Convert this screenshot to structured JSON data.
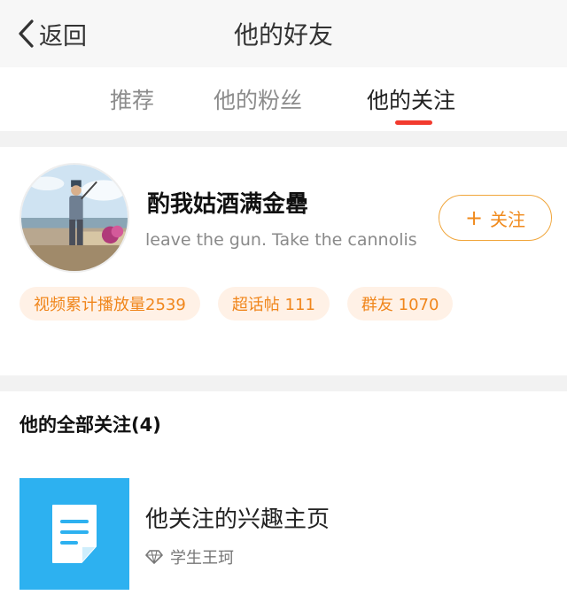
{
  "nav": {
    "back_label": "返回",
    "title": "他的好友"
  },
  "tabs": [
    {
      "label": "推荐"
    },
    {
      "label": "他的粉丝"
    },
    {
      "label": "他的关注"
    }
  ],
  "active_tab": "他的关注",
  "profile": {
    "name": "酌我姑酒满金罍",
    "bio": "leave the gun. Take the cannolis",
    "follow_button": {
      "plus": "+",
      "label": "关注"
    },
    "tags": [
      {
        "text": "视频累计播放量2539"
      },
      {
        "text": "超话帖 111"
      },
      {
        "text": "群友 1070"
      }
    ]
  },
  "following": {
    "section_title": "他的全部关注(4)",
    "items": [
      {
        "title": "他关注的兴趣主页",
        "subtitle": "学生王珂",
        "icon": "document-icon",
        "badge_icon": "diamond-icon"
      }
    ]
  },
  "colors": {
    "accent": "#f08a1c",
    "tab_underline": "#f23a2e",
    "item_icon_bg": "#2db1f0",
    "tag_bg": "#fff1e6"
  }
}
